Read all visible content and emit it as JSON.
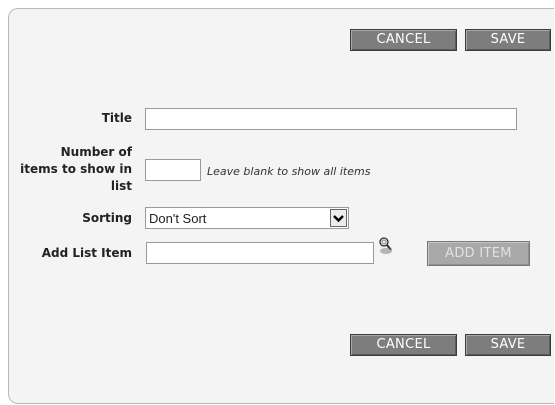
{
  "buttons": {
    "cancel_label": "CANCEL",
    "save_label": "SAVE",
    "add_item_label": "ADD ITEM"
  },
  "form": {
    "title_label": "Title",
    "title_value": "",
    "number_label_line1": "Number of",
    "number_label_line2": "items to show in",
    "number_label_line3": "list",
    "number_value": "",
    "number_hint": "Leave blank to show all items",
    "sorting_label": "Sorting",
    "sorting_selected": "Don't Sort",
    "add_list_item_label": "Add List Item",
    "add_list_item_value": ""
  },
  "icons": {
    "search": "search-icon",
    "dropdown": "chevron-down-icon"
  }
}
